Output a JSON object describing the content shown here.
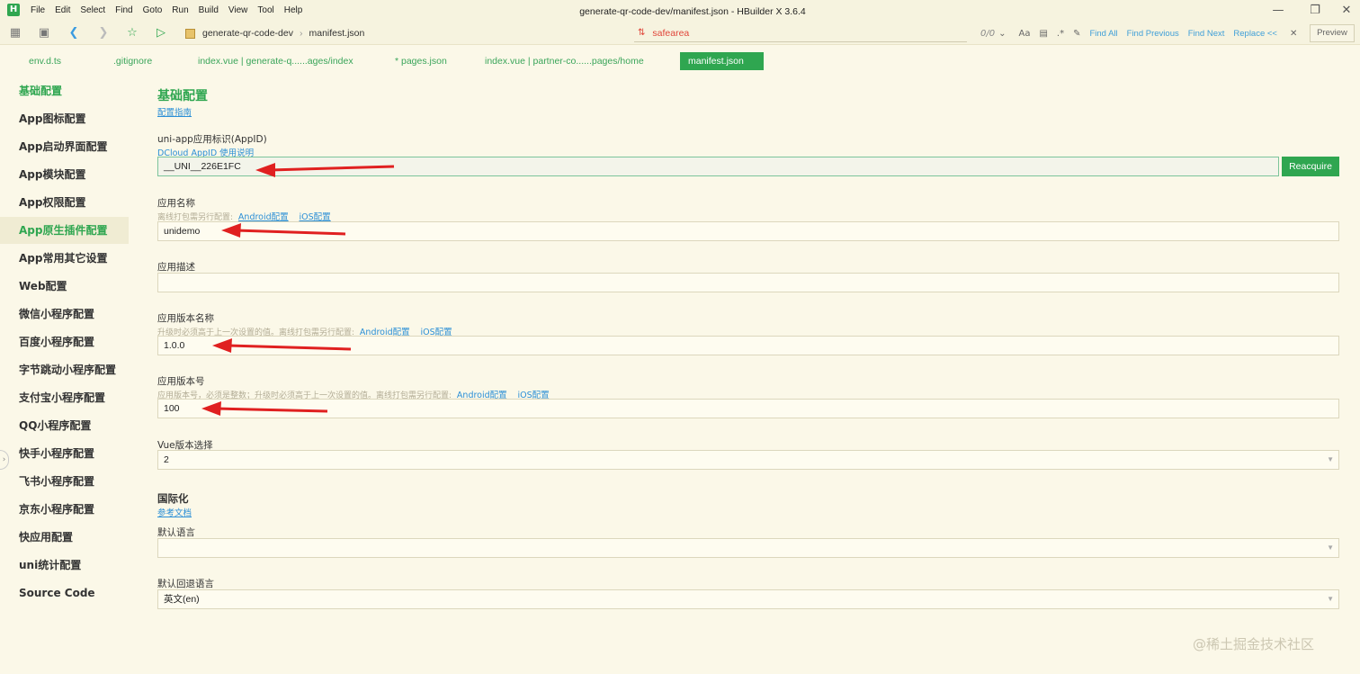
{
  "app": {
    "logo_letter": "H",
    "window_title": "generate-qr-code-dev/manifest.json - HBuilder X 3.6.4",
    "menu": [
      "File",
      "Edit",
      "Select",
      "Find",
      "Goto",
      "Run",
      "Build",
      "View",
      "Tool",
      "Help"
    ],
    "accent_color": "#2fa650",
    "link_color": "#2b8fd6"
  },
  "toolbar": {
    "icons": [
      "file-icon",
      "save-icon",
      "back-icon",
      "forward-icon",
      "bookmark-star-icon",
      "run-icon"
    ],
    "breadcrumb": [
      "generate-qr-code-dev",
      "manifest.json"
    ],
    "find": {
      "query": "safearea",
      "count": "0/0",
      "find_all": "Find All",
      "find_previous": "Find Previous",
      "find_next": "Find Next",
      "replace": "Replace <<"
    },
    "preview_label": "Preview"
  },
  "tabs": [
    {
      "label": "env.d.ts",
      "active": false
    },
    {
      "label": ".gitignore",
      "active": false
    },
    {
      "label": "index.vue | generate-q......ages/index",
      "active": false
    },
    {
      "label": "* pages.json",
      "active": false
    },
    {
      "label": "index.vue | partner-co......pages/home",
      "active": false
    },
    {
      "label": "manifest.json",
      "active": true
    }
  ],
  "sidebar": {
    "items": [
      {
        "label": "基础配置"
      },
      {
        "label": "App图标配置"
      },
      {
        "label": "App启动界面配置"
      },
      {
        "label": "App模块配置"
      },
      {
        "label": "App权限配置"
      },
      {
        "label": "App原生插件配置"
      },
      {
        "label": "App常用其它设置"
      },
      {
        "label": "Web配置"
      },
      {
        "label": "微信小程序配置"
      },
      {
        "label": "百度小程序配置"
      },
      {
        "label": "字节跳动小程序配置"
      },
      {
        "label": "支付宝小程序配置"
      },
      {
        "label": "QQ小程序配置"
      },
      {
        "label": "快手小程序配置"
      },
      {
        "label": "飞书小程序配置"
      },
      {
        "label": "京东小程序配置"
      },
      {
        "label": "快应用配置"
      },
      {
        "label": "uni统计配置"
      },
      {
        "label": "Source Code"
      }
    ]
  },
  "main": {
    "title": "基础配置",
    "guide_link": "配置指南",
    "appid": {
      "label": "uni-app应用标识(AppID)",
      "help_link": "DCloud AppID 使用说明",
      "value": "__UNI__226E1FC",
      "button": "Reacquire"
    },
    "app_name": {
      "label": "应用名称",
      "hint": "离线打包需另行配置:",
      "android_link": "Android配置",
      "ios_link": "iOS配置",
      "value": "unidemo"
    },
    "app_desc": {
      "label": "应用描述",
      "value": ""
    },
    "version_name": {
      "label": "应用版本名称",
      "hint": "升级时必须高于上一次设置的值。离线打包需另行配置:",
      "android_link": "Android配置",
      "ios_link": "iOS配置",
      "value": "1.0.0"
    },
    "version_code": {
      "label": "应用版本号",
      "hint": "应用版本号，必须是整数；升级时必须高于上一次设置的值。离线打包需另行配置:",
      "android_link": "Android配置",
      "ios_link": "iOS配置",
      "value": "100"
    },
    "vue_version": {
      "label": "Vue版本选择",
      "value": "2"
    },
    "i18n": {
      "title": "国际化",
      "doc_link": "参考文档",
      "default_lang_label": "默认语言",
      "default_lang_value": "",
      "fallback_lang_label": "默认回退语言",
      "fallback_lang_value": "英文(en)"
    }
  },
  "watermark": "@稀土掘金技术社区"
}
